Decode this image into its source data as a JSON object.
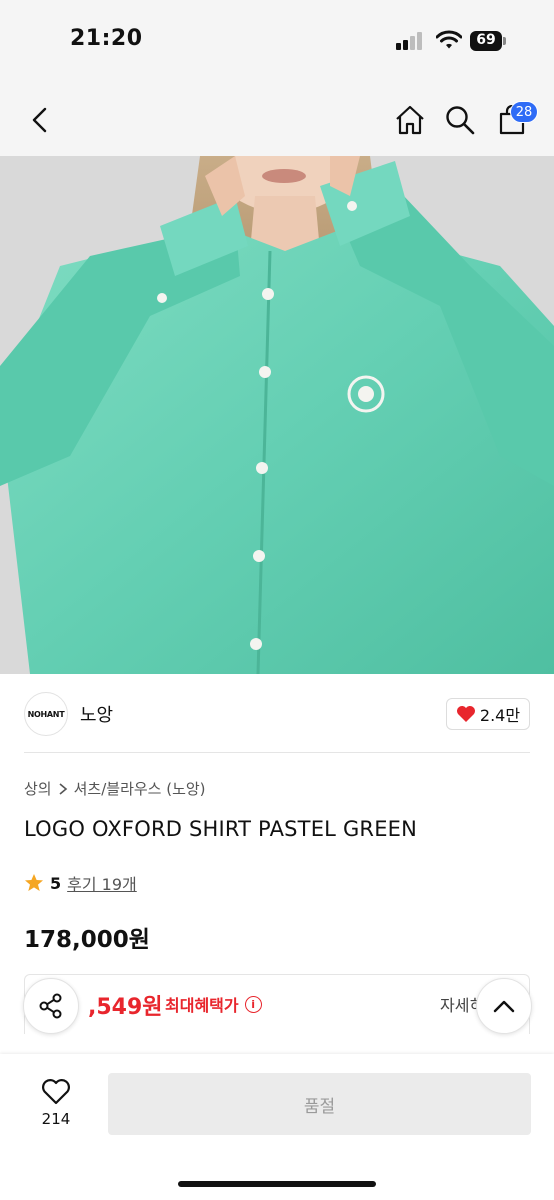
{
  "status_bar": {
    "time": "21:20",
    "battery": "69"
  },
  "nav": {
    "cart_count": "28"
  },
  "brand": {
    "logo_text": "NOHANT",
    "name": "노앙",
    "likes": "2.4만"
  },
  "breadcrumb": {
    "category": "상의",
    "subcategory": "셔츠/블라우스 (노앙)"
  },
  "product": {
    "title": "LOGO OXFORD SHIRT PASTEL GREEN",
    "rating": "5",
    "reviews": "후기 19개",
    "price": "178,000원"
  },
  "benefit": {
    "price": ",549원",
    "label": "최대혜택가",
    "detail": "자세히"
  },
  "bottom_bar": {
    "wish_count": "214",
    "soldout_label": "품절"
  },
  "colors": {
    "accent_blue": "#2f6cf6",
    "sale_red": "#e8262d",
    "shirt_mint": "#6fd3b8"
  }
}
